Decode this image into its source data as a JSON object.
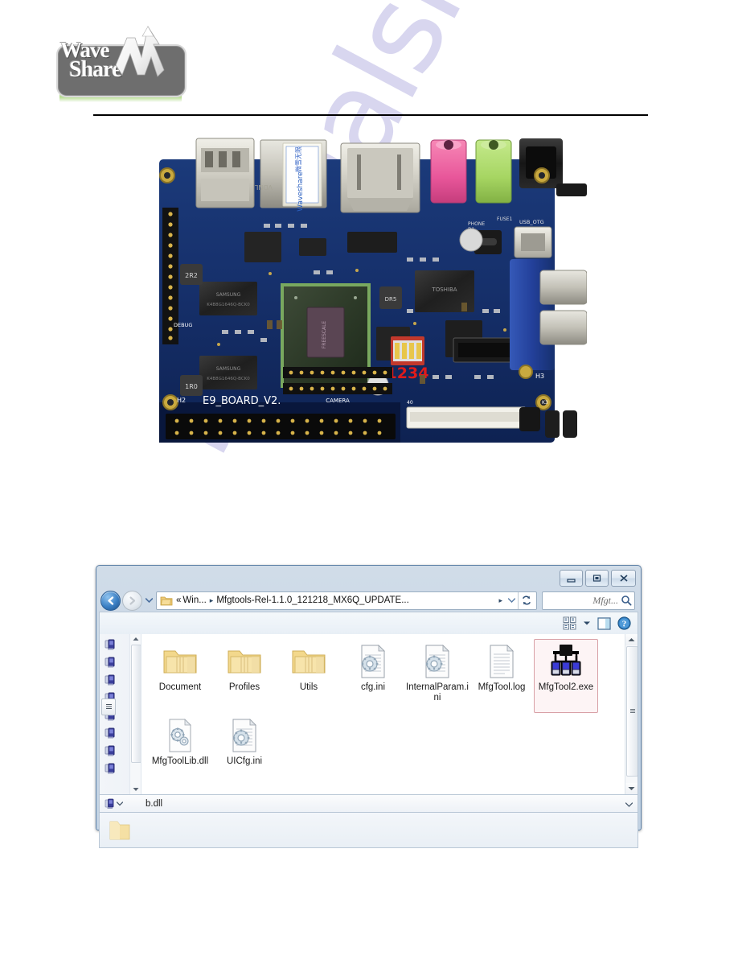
{
  "document": {
    "brand": {
      "logo_line1": "Wave",
      "logo_line2": "Share",
      "logo_mark": "W-arrow-mark",
      "colors": {
        "plate": "#6e6e6e",
        "green": "#b7dd92"
      }
    },
    "watermark": "manualshelf"
  },
  "photo": {
    "alt": "i.MX6Q E9 single board computer top view",
    "silkscreen": {
      "board_name": "E9_BOARD_V2.",
      "camera_header": "CAMERA",
      "dip_switch_label": "1234",
      "usb_otg": "USB_OTG",
      "phone": "PHONE",
      "fuse": "FUSE1",
      "debug": "DEBUG",
      "h2": "H2",
      "h3": "H3",
      "soc_vendor": "TOSHIBA",
      "ram_vendor": "SAMSUNG",
      "sticker_text": "Waveshare"
    },
    "colors": {
      "pcb": "#15306b",
      "soc_heatspreader": "#3f4a3a",
      "soc_frame": "#6ea05a",
      "audio_pink": "#ef6fa8",
      "audio_green": "#a8d96a",
      "vga_blue": "#2b4fa8",
      "connector_silver": "#cfcfcf",
      "red_text": "#e01b1b"
    }
  },
  "explorer": {
    "titlebar": {
      "minimize_tooltip": "Minimize",
      "maximize_tooltip": "Maximize",
      "close_tooltip": "Close"
    },
    "navigation": {
      "back_tooltip": "Back",
      "forward_tooltip": "Forward",
      "recent_tooltip": "Recent pages",
      "refresh_tooltip": "Refresh"
    },
    "address": {
      "overflow": "«",
      "crumb1": "Win...",
      "crumb_current": "Mfgtools-Rel-1.1.0_121218_MX6Q_UPDATE...",
      "separator": "▸"
    },
    "search": {
      "placeholder": "Mfgt...",
      "icon": "search-icon"
    },
    "toolbar": {
      "views_tooltip": "Change your view",
      "views_caret": "▾",
      "preview_tooltip": "Show the preview pane",
      "help_tooltip": "Get help",
      "help_glyph": "?"
    },
    "nav_pane": {
      "item_count": 8,
      "item_icon": "computer-icon"
    },
    "files": [
      {
        "name": "Document",
        "icon": "folder-icon",
        "selected": false
      },
      {
        "name": "Profiles",
        "icon": "folder-icon",
        "selected": false
      },
      {
        "name": "Utils",
        "icon": "folder-icon",
        "selected": false
      },
      {
        "name": "cfg.ini",
        "icon": "ini-file-icon",
        "selected": false
      },
      {
        "name": "InternalParam.ini",
        "icon": "ini-file-icon",
        "selected": false
      },
      {
        "name": "MfgTool.log",
        "icon": "log-file-icon",
        "selected": false
      },
      {
        "name": "MfgTool2.exe",
        "icon": "mfgtool-exe-icon",
        "selected": true
      },
      {
        "name": "MfgToolLib.dll",
        "icon": "dll-file-icon",
        "selected": false
      },
      {
        "name": "UICfg.ini",
        "icon": "ini-file-icon",
        "selected": false
      }
    ],
    "details": {
      "label": "b.dll",
      "caret": "▾"
    },
    "status": {
      "icon": "folder-icon"
    }
  }
}
